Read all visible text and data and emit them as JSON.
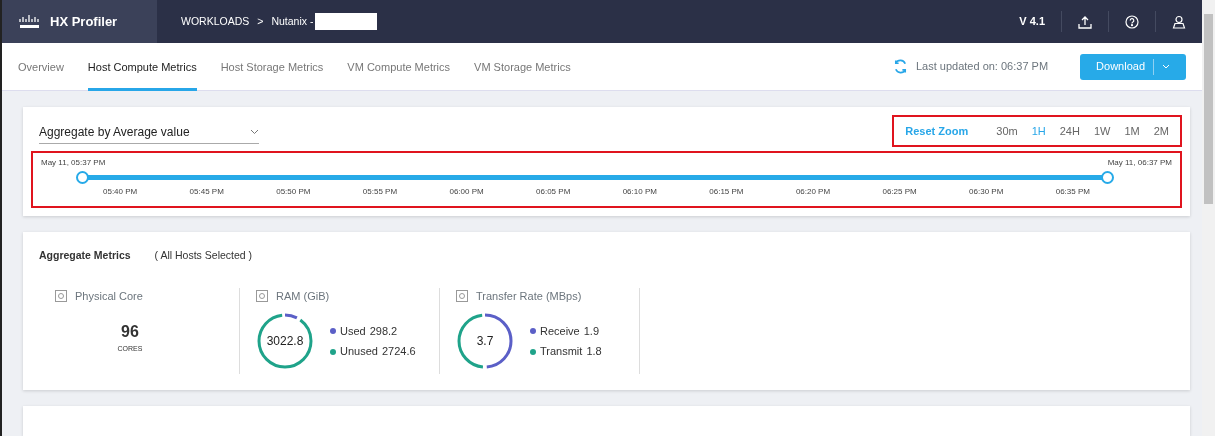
{
  "header": {
    "brand": "HX Profiler",
    "breadcrumb": [
      {
        "label": "WORKLOADS"
      },
      {
        "label": "Nutanix -"
      }
    ],
    "separator": ">",
    "version": "V 4.1"
  },
  "tabs": [
    {
      "label": "Overview",
      "selected": false
    },
    {
      "label": "Host Compute Metrics",
      "selected": true
    },
    {
      "label": "Host Storage Metrics",
      "selected": false
    },
    {
      "label": "VM Compute Metrics",
      "selected": false
    },
    {
      "label": "VM Storage Metrics",
      "selected": false
    }
  ],
  "last_updated": "Last updated on: 06:37 PM",
  "download_button": "Download",
  "aggregate_select": {
    "value": "Aggregate by Average value"
  },
  "reset_zoom": "Reset Zoom",
  "ranges": [
    {
      "label": "30m",
      "selected": false
    },
    {
      "label": "1H",
      "selected": true
    },
    {
      "label": "24H",
      "selected": false
    },
    {
      "label": "1W",
      "selected": false
    },
    {
      "label": "1M",
      "selected": false
    },
    {
      "label": "2M",
      "selected": false
    }
  ],
  "timeline": {
    "level": 1,
    "start": "May 11, 05:37 PM",
    "end": "May 11, 06:37 PM",
    "ticks": [
      "05:40 PM",
      "05:45 PM",
      "05:50 PM",
      "05:55 PM",
      "06:00 PM",
      "06:05 PM",
      "06:10 PM",
      "06:15 PM",
      "06:20 PM",
      "06:25 PM",
      "06:30 PM",
      "06:35 PM"
    ]
  },
  "aggregate_metrics": {
    "title": "Aggregate Metrics",
    "subtitle": "( All Hosts Selected )",
    "metrics": [
      {
        "kind": "count",
        "title": "Physical Core",
        "value": "96",
        "unit": "CORES"
      },
      {
        "kind": "donut",
        "title": "RAM (GiB)",
        "value": "3022.8",
        "series": [
          {
            "name": "Used",
            "value": "298.2",
            "color": "#5b5fc7",
            "level": 0.1
          },
          {
            "name": "Unused",
            "value": "2724.6",
            "color": "#1fa38a",
            "level": 0.9
          }
        ]
      },
      {
        "kind": "donut",
        "title": "Transfer Rate (MBps)",
        "value": "3.7",
        "series": [
          {
            "name": "Receive",
            "value": "1.9",
            "color": "#5b5fc7",
            "level": 0.51
          },
          {
            "name": "Transmit",
            "value": "1.8",
            "color": "#1fa38a",
            "level": 0.49
          }
        ]
      }
    ]
  }
}
